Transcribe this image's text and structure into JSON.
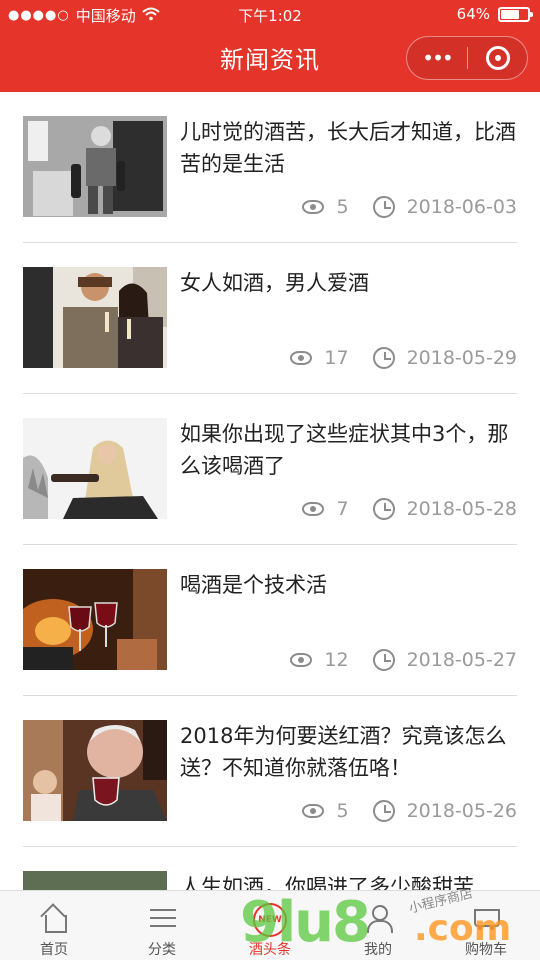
{
  "status_bar": {
    "carrier": "中国移动",
    "time": "下午1:02",
    "battery": "64%"
  },
  "header": {
    "title": "新闻资讯",
    "more_label": "•••"
  },
  "news": [
    {
      "title": "儿时觉的酒苦，长大后才知道，比酒苦的是生活",
      "views": "5",
      "date": "2018-06-03"
    },
    {
      "title": "女人如酒，男人爱酒",
      "views": "17",
      "date": "2018-05-29"
    },
    {
      "title": "如果你出现了这些症状其中3个，那么该喝酒了",
      "views": "7",
      "date": "2018-05-28"
    },
    {
      "title": "喝酒是个技术活",
      "views": "12",
      "date": "2018-05-27"
    },
    {
      "title": "2018年为何要送红酒？究竟该怎么送？不知道你就落伍咯！",
      "views": "5",
      "date": "2018-05-26"
    },
    {
      "title": "人生如酒，你喝进了多少酸甜苦",
      "views": "",
      "date": ""
    }
  ],
  "tabs": [
    {
      "label": "首页",
      "icon": "home-icon"
    },
    {
      "label": "分类",
      "icon": "list-icon"
    },
    {
      "label": "酒头条",
      "icon": "new-badge-icon",
      "badge": "NEW"
    },
    {
      "label": "我的",
      "icon": "user-icon"
    },
    {
      "label": "购物车",
      "icon": "cart-icon"
    }
  ],
  "watermark": {
    "brand": "9lu8",
    "domain": ".com",
    "handwritten": "小程序商店"
  }
}
